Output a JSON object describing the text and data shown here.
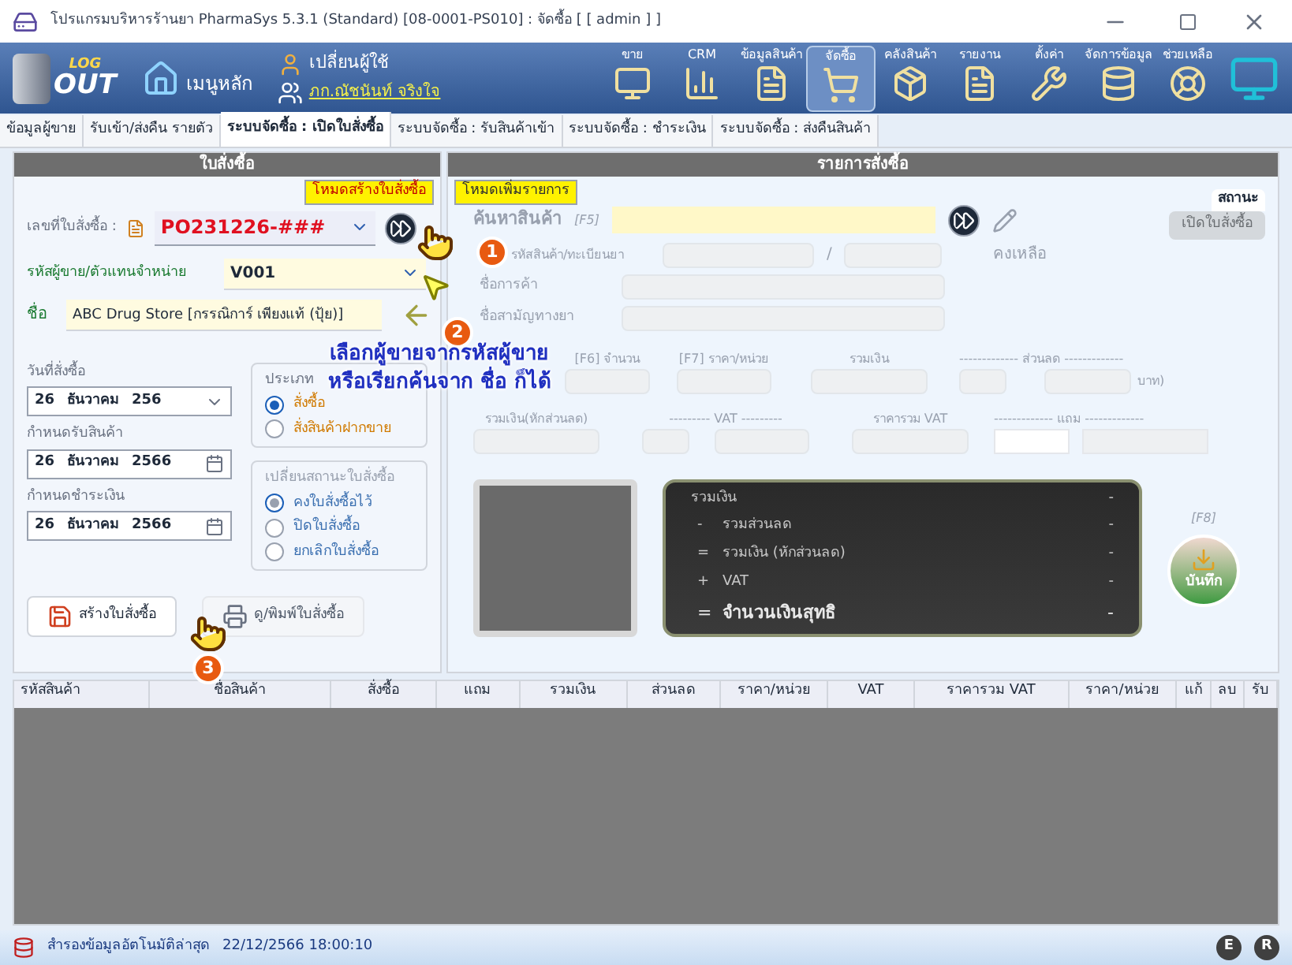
{
  "window": {
    "title": "โปรแกรมบริหารร้านยา PharmaSys 5.3.1 (Standard) [08-0001-PS010] : จัดซื้อ  [ [ admin ] ]"
  },
  "toolbar": {
    "logout": [
      "LOG",
      "OUT"
    ],
    "home": "เมนูหลัก",
    "switch_user": "เปลี่ยนผู้ใช้",
    "user": "ภก.ณัชนันท์ จริงใจ",
    "items": [
      {
        "label": "ขาย",
        "kind": "sale",
        "selected": false
      },
      {
        "label": "CRM",
        "kind": "crm",
        "selected": false
      },
      {
        "label": "ข้อมูลสินค้า",
        "kind": "product",
        "selected": false
      },
      {
        "label": "จัดซื้อ",
        "kind": "purchase",
        "selected": true
      },
      {
        "label": "คลังสินค้า",
        "kind": "stock",
        "selected": false
      },
      {
        "label": "รายงาน",
        "kind": "report",
        "selected": false
      },
      {
        "label": "ตั้งค่า",
        "kind": "settings",
        "selected": false
      },
      {
        "label": "จัดการข้อมูล",
        "kind": "data",
        "selected": false
      },
      {
        "label": "ช่วยเหลือ",
        "kind": "help",
        "selected": false
      }
    ]
  },
  "tabs": [
    {
      "label": "ข้อมูลผู้ขาย",
      "selected": false
    },
    {
      "label": "รับเข้า/ส่งคืน รายตัว",
      "selected": false
    },
    {
      "label": "ระบบจัดซื้อ : เปิดใบสั่งซื้อ",
      "selected": true
    },
    {
      "label": "ระบบจัดซื้อ : รับสินค้าเข้า",
      "selected": false
    },
    {
      "label": "ระบบจัดซื้อ : ชำระเงิน",
      "selected": false
    },
    {
      "label": "ระบบจัดซื้อ : ส่งคืนสินค้า",
      "selected": false
    }
  ],
  "order": {
    "title": "ใบสั่งซื้อ",
    "mode": "โหมดสร้างใบสั่งซื้อ",
    "po_label": "เลขที่ใบสั่งซื้อ :",
    "po_number": "PO231226-###",
    "vendor_code_label": "รหัสผู้ขาย/ตัวแทนจำหน่าย",
    "vendor_code": "V001",
    "name_label": "ชื่อ",
    "vendor_name": "ABC Drug Store [กรรณิการ์ เพียงแท้ (ปุ้ย)]",
    "dates": [
      {
        "label": "วันที่สั่งซื้อ",
        "day": "26",
        "month": "ธันวาคม",
        "year": "256",
        "kind": "dropdown"
      },
      {
        "label": "กำหนดรับสินค้า",
        "day": "26",
        "month": "ธันวาคม",
        "year": "2566",
        "kind": "calendar"
      },
      {
        "label": "กำหนดชำระเงิน",
        "day": "26",
        "month": "ธันวาคม",
        "year": "2566",
        "kind": "calendar"
      }
    ],
    "type_group": {
      "title": "ประเภท",
      "options": [
        {
          "label": "สั่งซื้อ",
          "selected": true
        },
        {
          "label": "สั่งสินค้าฝากขาย",
          "selected": false
        }
      ]
    },
    "status_group": {
      "title": "เปลี่ยนสถานะใบสั่งซื้อ",
      "options": [
        {
          "label": "คงใบสั่งซื้อไว้",
          "selected": true
        },
        {
          "label": "ปิดใบสั่งซื้อ",
          "selected": false
        },
        {
          "label": "ยกเลิกใบสั่งซื้อ",
          "selected": false
        }
      ]
    },
    "buttons": [
      {
        "label": "สร้างใบสั่งซื้อ",
        "kind": "save"
      },
      {
        "label": "ดู/พิมพ์ใบสั่งซื้อ",
        "kind": "print"
      }
    ]
  },
  "items_entry": {
    "title": "รายการสั่งซื้อ",
    "mode": "โหมดเพิ่มรายการ",
    "disabled": true,
    "search_label": "ค้นหาสินค้า",
    "search_key": "[F5]",
    "code_label": "รหัสสินค้า/ทะเบียนยา",
    "remaining": "คงเหลือ",
    "trade_label": "ชื่อการค้า",
    "generic_label": "ชื่อสามัญทางยา",
    "status_label": "สถานะ",
    "status_button": "เปิดใบสั่งซื้อ",
    "row1": {
      "qty": "[F6] จำนวน",
      "price": "[F7] ราคา/หน่วย",
      "total": "รวมเงิน",
      "discount": "------------- ส่วนลด -------------",
      "baht": "บาท)"
    },
    "row2": {
      "net": "รวมเงิน(หักส่วนลด)",
      "vat": "--------- VAT ---------",
      "vat_total": "ราคารวม VAT",
      "free": "------------- แถม -------------"
    },
    "separator": "/",
    "summary": [
      {
        "label": "รวมเงิน",
        "value": "-",
        "bold": false
      },
      {
        "op": "-",
        "label": "รวมส่วนลด",
        "value": "-",
        "bold": false
      },
      {
        "op": "=",
        "label": "รวมเงิน (หักส่วนลด)",
        "value": "-",
        "bold": false
      },
      {
        "op": "+",
        "label": "VAT",
        "value": "-",
        "bold": false
      },
      {
        "op": "=",
        "label": "จำนวนเงินสุทธิ",
        "value": "-",
        "bold": true
      }
    ],
    "save_key": "[F8]",
    "save_label": "บันทึก"
  },
  "table": {
    "columns": [
      "รหัสสินค้า",
      "ชื่อสินค้า",
      "สั่งซื้อ",
      "แถม",
      "รวมเงิน",
      "ส่วนลด",
      "ราคา/หน่วย",
      "VAT",
      "ราคารวม VAT",
      "ราคา/หน่วย",
      "แก้",
      "ลบ",
      "รับ"
    ]
  },
  "status_bar": {
    "label": "สำรองข้อมูลอัตโนมัติล่าสุด",
    "time": "22/12/2566 18:00:10",
    "badges": [
      "E",
      "R"
    ]
  },
  "annotations": {
    "steps": [
      "1",
      "2",
      "3"
    ],
    "caption": [
      "เลือกผู้ขายจากรหัสผู้ขาย",
      "หรือเรียกค้นจาก ชื่อ ก็ได้"
    ]
  }
}
